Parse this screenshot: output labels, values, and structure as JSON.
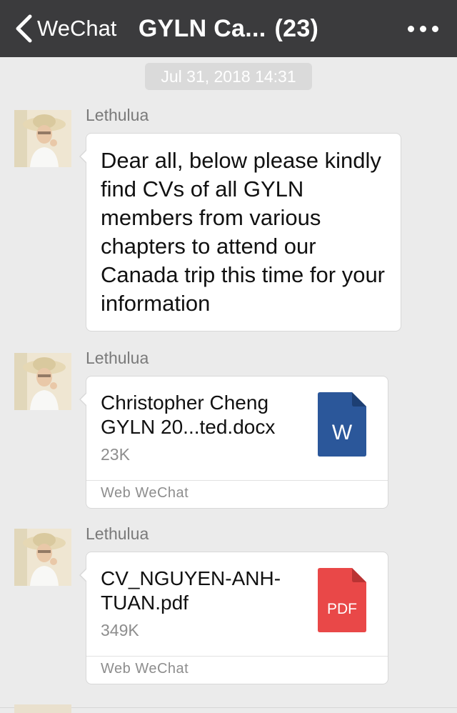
{
  "header": {
    "back_label": "WeChat",
    "title": "GYLN Ca...",
    "member_count": "(23)"
  },
  "timestamp": "Jul 31, 2018 14:31",
  "messages": [
    {
      "sender": "Lethulua",
      "type": "text",
      "text": "Dear all, below please kindly find CVs of all GYLN members from various chapters to attend our Canada trip this time for your information"
    },
    {
      "sender": "Lethulua",
      "type": "file",
      "file_name": "Christopher Cheng GYLN 20...ted.docx",
      "file_size": "23K",
      "file_type_label": "W",
      "file_icon": "word-document-icon",
      "source": "Web WeChat"
    },
    {
      "sender": "Lethulua",
      "type": "file",
      "file_name": "CV_NGUYEN-ANH-TUAN.pdf",
      "file_size": "349K",
      "file_type_label": "PDF",
      "file_icon": "pdf-document-icon",
      "source": "Web WeChat"
    }
  ],
  "colors": {
    "header_bg": "#3b3b3d",
    "chat_bg": "#ebebeb",
    "word_blue": "#2b579a",
    "pdf_red": "#e94848"
  }
}
